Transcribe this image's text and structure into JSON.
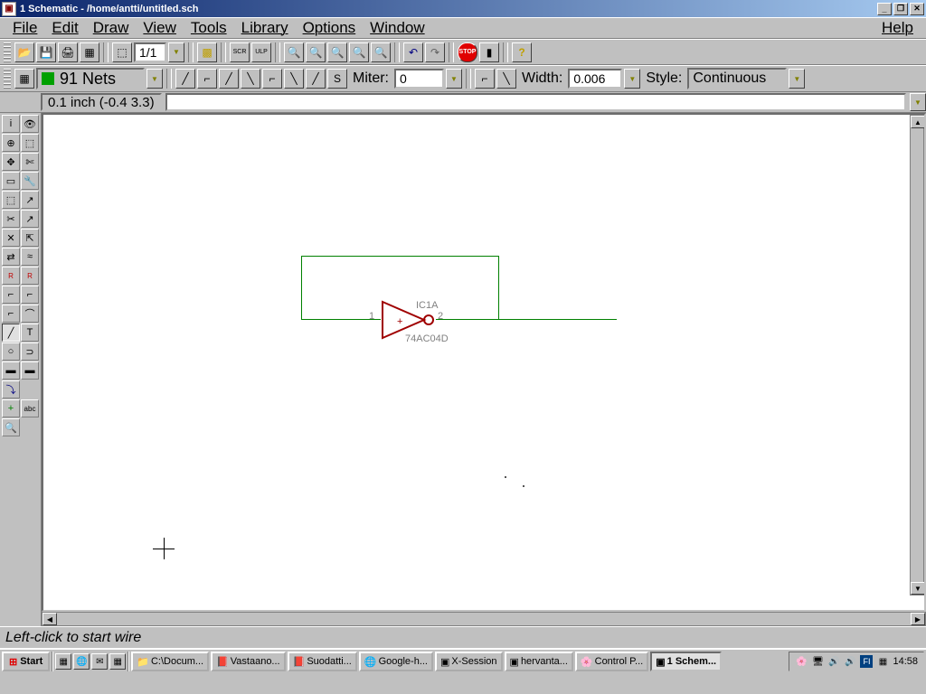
{
  "titlebar": {
    "icon_label": "▣",
    "text": "1 Schematic - /home/antti/untitled.sch",
    "min": "_",
    "max": "❐",
    "close": "✕"
  },
  "menubar": {
    "file": "File",
    "edit": "Edit",
    "draw": "Draw",
    "view": "View",
    "tools": "Tools",
    "library": "Library",
    "options": "Options",
    "window": "Window",
    "help": "Help"
  },
  "toolbar1": {
    "open": "📂",
    "save": "💾",
    "print": "🖨",
    "cam": "▦",
    "sheet_sel": "⬚",
    "sheet_label": "1/1",
    "board": "▩",
    "scr": "SCR",
    "ulp": "ULP",
    "zoom_out": "🔍",
    "zoom_in": "🔍",
    "zoom_fit": "🔍",
    "zoom_redraw": "🔍",
    "zoom_sel": "🔍",
    "undo": "↶",
    "redo": "↷",
    "stop": "STOP",
    "go": "▮",
    "help": "?"
  },
  "toolbar2": {
    "nets_label": "91 Nets",
    "wire_styles": [
      "╱",
      "⌐",
      "╱",
      "╲",
      "⌐",
      "╲",
      "╱",
      "S"
    ],
    "miter_label": "Miter:",
    "miter_val": "0",
    "width_label": "Width:",
    "width_val": "0.006",
    "style_label": "Style:",
    "style_val": "Continuous"
  },
  "coordbar": {
    "coord_text": "0.1 inch (-0.4 3.3)",
    "cmd": ""
  },
  "left_tools": [
    [
      "i",
      "👁"
    ],
    [
      "⊕",
      "⬚"
    ],
    [
      "✥",
      "✄"
    ],
    [
      "▭",
      "🔧"
    ],
    [
      "⬚",
      "↗"
    ],
    [
      "✂",
      "↗"
    ],
    [
      "✕",
      "⇱"
    ],
    [
      "⇄",
      "≈"
    ],
    [
      "R",
      "R"
    ],
    [
      "⌐",
      "⌐"
    ],
    [
      "⌐",
      "⌒"
    ],
    [
      "╱",
      "T"
    ],
    [
      "○",
      "⊃"
    ],
    [
      "▬",
      "▬"
    ],
    [
      "⤵",
      ""
    ],
    [
      "+",
      "abc"
    ],
    [
      "🔍",
      ""
    ]
  ],
  "schematic": {
    "ic_name": "IC1A",
    "ic_value": "74AC04D",
    "pin1": "1",
    "pin2": "2"
  },
  "status": "Left-click to start wire",
  "taskbar": {
    "start": "Start",
    "qlaunch": [
      "▦",
      "🌐",
      "✉",
      "▦"
    ],
    "tasks": [
      {
        "label": "C:\\Docum...",
        "icon": "📁"
      },
      {
        "label": "Vastaano...",
        "icon": "📕"
      },
      {
        "label": "Suodatti...",
        "icon": "📕"
      },
      {
        "label": "Google-h...",
        "icon": "🌐"
      },
      {
        "label": "X-Session",
        "icon": "▣"
      },
      {
        "label": "hervanta...",
        "icon": "▣"
      },
      {
        "label": "Control P...",
        "icon": "🌸"
      },
      {
        "label": "1 Schem...",
        "icon": "▣",
        "active": true
      }
    ],
    "tray_icons": [
      "🌸",
      "🖥",
      "🔊",
      "🔊",
      "FI",
      "▦"
    ],
    "clock": "14:58"
  }
}
